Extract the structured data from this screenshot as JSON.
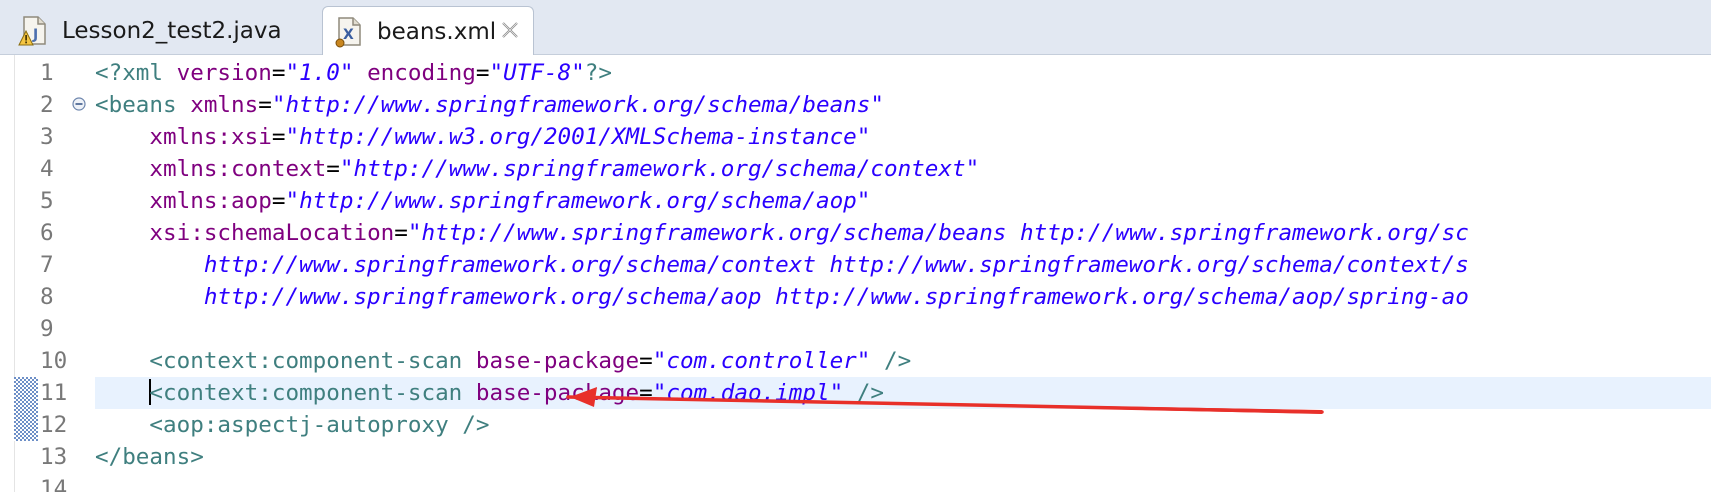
{
  "tabs": [
    {
      "label": "Lesson2_test2.java",
      "icon": "java-file-warning-icon",
      "active": false
    },
    {
      "label": "beans.xml",
      "icon": "xml-file-icon",
      "active": true
    }
  ],
  "editor": {
    "lines": [
      {
        "num": "1",
        "indent": "",
        "tokens": [
          [
            "pi",
            "<?xml"
          ],
          [
            "attr",
            " version"
          ],
          [
            "punct",
            "="
          ],
          [
            "val",
            "\"1.0\""
          ],
          [
            "attr",
            " encoding"
          ],
          [
            "punct",
            "="
          ],
          [
            "val",
            "\"UTF-8\""
          ],
          [
            "pi",
            "?>"
          ]
        ]
      },
      {
        "num": "2",
        "fold": true,
        "indent": "",
        "tokens": [
          [
            "tag",
            "<beans"
          ],
          [
            "attr",
            " xmlns"
          ],
          [
            "punct",
            "="
          ],
          [
            "val",
            "\"http://www.springframework.org/schema/beans\""
          ]
        ]
      },
      {
        "num": "3",
        "indent": "    ",
        "tokens": [
          [
            "attr",
            "xmlns:xsi"
          ],
          [
            "punct",
            "="
          ],
          [
            "val",
            "\"http://www.w3.org/2001/XMLSchema-instance\""
          ]
        ]
      },
      {
        "num": "4",
        "indent": "    ",
        "tokens": [
          [
            "attr",
            "xmlns:context"
          ],
          [
            "punct",
            "="
          ],
          [
            "val",
            "\"http://www.springframework.org/schema/context\""
          ]
        ]
      },
      {
        "num": "5",
        "indent": "    ",
        "tokens": [
          [
            "attr",
            "xmlns:aop"
          ],
          [
            "punct",
            "="
          ],
          [
            "val",
            "\"http://www.springframework.org/schema/aop\""
          ]
        ]
      },
      {
        "num": "6",
        "indent": "    ",
        "tokens": [
          [
            "attr",
            "xsi:schemaLocation"
          ],
          [
            "punct",
            "="
          ],
          [
            "val",
            "\"http://www.springframework.org/schema/beans http://www.springframework.org/sc"
          ]
        ]
      },
      {
        "num": "7",
        "indent": "        ",
        "tokens": [
          [
            "val",
            "http://www.springframework.org/schema/context http://www.springframework.org/schema/context/s"
          ]
        ]
      },
      {
        "num": "8",
        "indent": "        ",
        "tokens": [
          [
            "val",
            "http://www.springframework.org/schema/aop http://www.springframework.org/schema/aop/spring-ao"
          ]
        ]
      },
      {
        "num": "9",
        "indent": "",
        "tokens": []
      },
      {
        "num": "10",
        "indent": "    ",
        "tokens": [
          [
            "tag",
            "<context:component-scan"
          ],
          [
            "attr",
            " base-package"
          ],
          [
            "punct",
            "="
          ],
          [
            "val",
            "\"com.controller\""
          ],
          [
            "tag",
            " />"
          ]
        ]
      },
      {
        "num": "11",
        "indent": "    ",
        "current": true,
        "marker": true,
        "caret": true,
        "tokens": [
          [
            "tag",
            "<context:component-scan"
          ],
          [
            "attr",
            " base-package"
          ],
          [
            "punct",
            "="
          ],
          [
            "val",
            "\"com.dao.impl\""
          ],
          [
            "tag",
            " />"
          ]
        ]
      },
      {
        "num": "12",
        "indent": "    ",
        "marker": true,
        "tokens": [
          [
            "tag",
            "<aop:aspectj-autoproxy"
          ],
          [
            "tag",
            " />"
          ]
        ]
      },
      {
        "num": "13",
        "indent": "",
        "tokens": [
          [
            "tag",
            "</beans>"
          ]
        ]
      },
      {
        "num": "14",
        "indent": "",
        "tokens": []
      }
    ]
  },
  "annotation": {
    "type": "red-arrow",
    "color": "#e8302a",
    "points_to": "line 12"
  }
}
